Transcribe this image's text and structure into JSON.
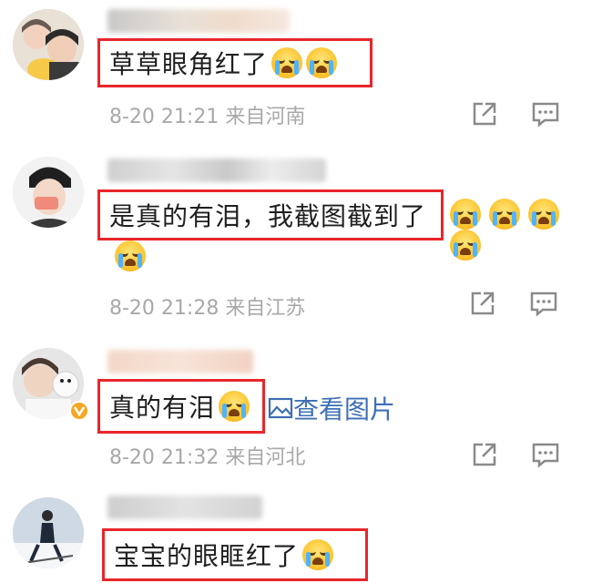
{
  "comments": [
    {
      "text": "草草眼角红了",
      "emoji_count": 2,
      "time": "8-20 21:21",
      "location": "来自河南"
    },
    {
      "text": "是真的有泪，我截图截到了",
      "emoji_count": 5,
      "time": "8-20 21:28",
      "location": "来自江苏"
    },
    {
      "text": "真的有泪",
      "emoji_count": 1,
      "view_picture": "查看图片",
      "time": "8-20 21:32",
      "location": "来自河北"
    },
    {
      "text": "宝宝的眼眶红了",
      "emoji_count": 1
    }
  ],
  "icons": {
    "share": "share-icon",
    "comment": "comment-icon",
    "picture": "picture-icon",
    "emoji": "crying-emoji-icon",
    "verified": "verified-badge-icon"
  },
  "colors": {
    "highlight_border": "#e8262b",
    "meta_text": "#a8a8a8",
    "link": "#3d6fb4"
  }
}
